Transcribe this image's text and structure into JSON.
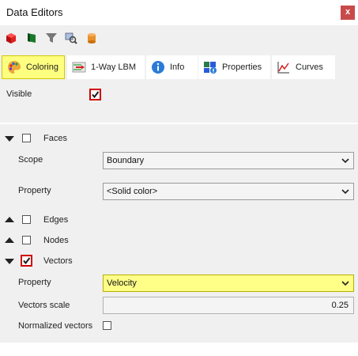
{
  "window": {
    "title": "Data Editors",
    "close_label": "x"
  },
  "toolbar": {
    "icons": [
      "red-cube-icon",
      "green-flag-icon",
      "funnel-icon",
      "search-data-icon",
      "cylinder-icon"
    ]
  },
  "tabs": [
    {
      "label": "Coloring",
      "icon": "palette-icon",
      "active": true
    },
    {
      "label": "1-Way LBM",
      "icon": "lbm-icon",
      "active": false
    },
    {
      "label": "Info",
      "icon": "info-icon",
      "active": false
    },
    {
      "label": "Properties",
      "icon": "properties-icon",
      "active": false
    },
    {
      "label": "Curves",
      "icon": "curves-icon",
      "active": false
    }
  ],
  "visible": {
    "label": "Visible",
    "checked": true
  },
  "faces": {
    "label": "Faces",
    "checked": false,
    "expanded": true,
    "scope_label": "Scope",
    "scope_value": "Boundary",
    "property_label": "Property",
    "property_value": "<Solid color>"
  },
  "edges": {
    "label": "Edges",
    "checked": false,
    "expanded": false
  },
  "nodes": {
    "label": "Nodes",
    "checked": false,
    "expanded": false
  },
  "vectors": {
    "label": "Vectors",
    "checked": true,
    "expanded": true,
    "property_label": "Property",
    "property_value": "Velocity",
    "scale_label": "Vectors scale",
    "scale_value": "0.25",
    "normalized_label": "Normalized vectors",
    "normalized_checked": false
  },
  "colors": {
    "highlight": "#ffff88",
    "tab_active": "#ffff80",
    "close": "#c94a4a",
    "check_border": "#d10000"
  }
}
